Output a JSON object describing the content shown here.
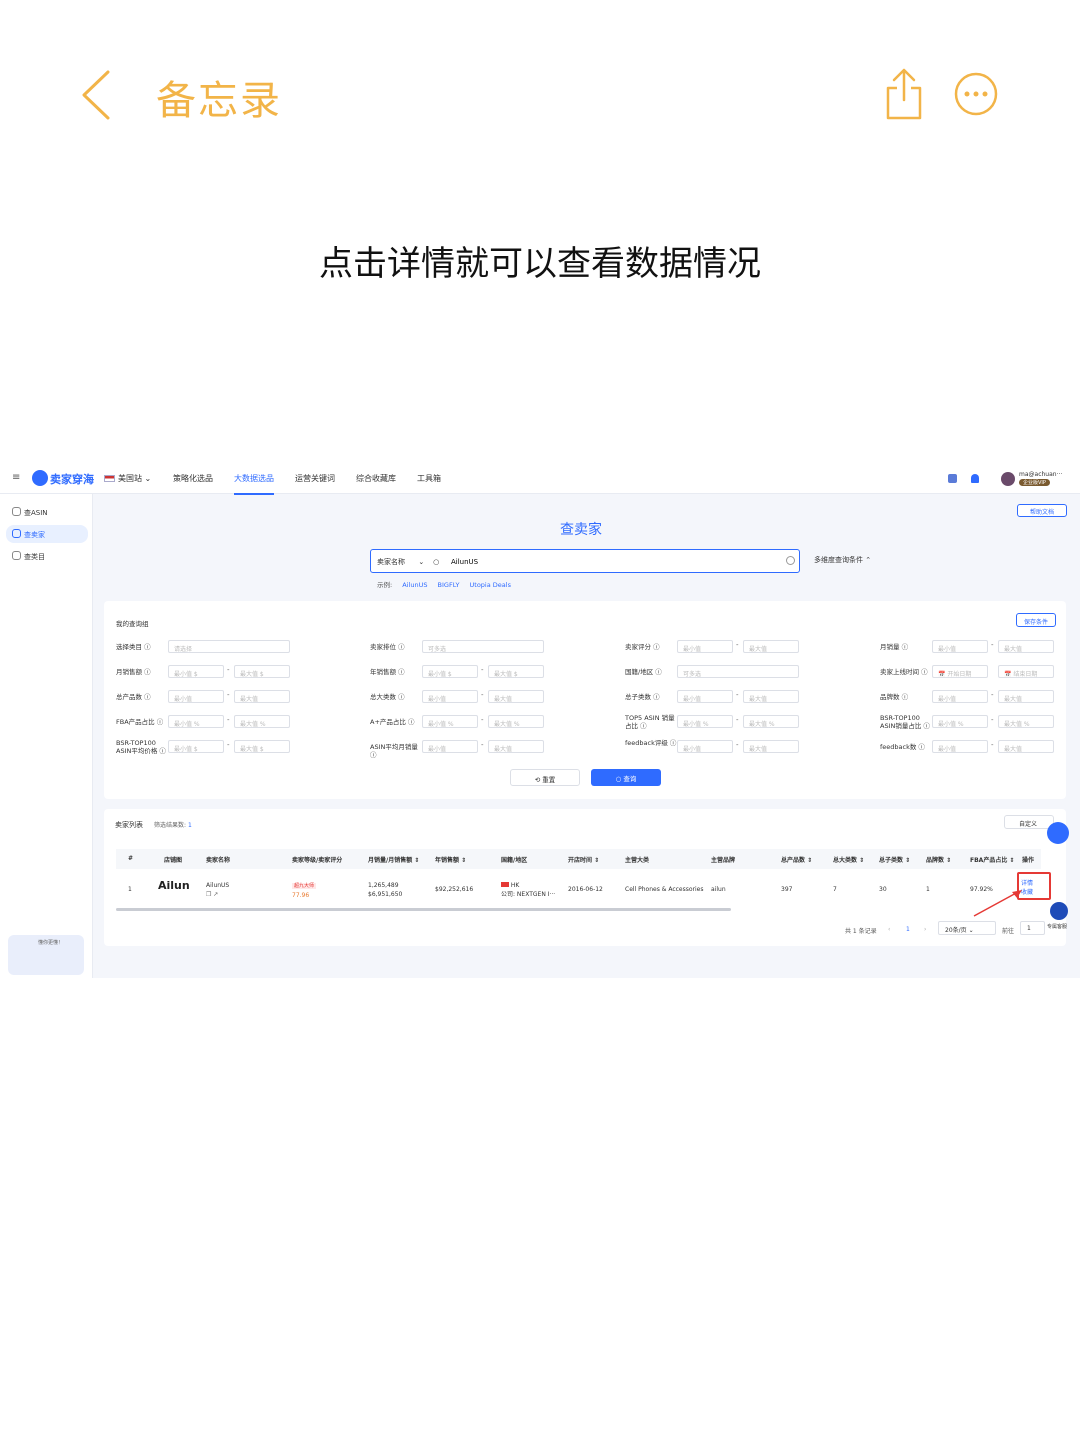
{
  "notes": {
    "title": "备忘录",
    "caption": "点击详情就可以查看数据情况"
  },
  "app": {
    "brand": "卖家穿海",
    "site": "美国站",
    "nav": [
      "策略化选品",
      "大数据选品",
      "运营关键词",
      "综合收藏库",
      "工具箱"
    ],
    "active_nav": "大数据选品",
    "user": "ma@achuan···",
    "vip": "企业版VIP",
    "help": "帮助文档"
  },
  "sidebar": {
    "items": [
      "查ASIN",
      "查卖家",
      "查类目"
    ],
    "promo": "懂你更懂！"
  },
  "search": {
    "page_title": "查卖家",
    "type": "卖家名称",
    "value": "AilunUS",
    "multi": "多维度查询条件 ⌃",
    "examples_label": "示例:",
    "examples": [
      "AilunUS",
      "BIGFLY",
      "Utopia Deals"
    ]
  },
  "filters": {
    "title": "我的查询组",
    "save": "保存条件",
    "min": "最小值",
    "max": "最大值",
    "select": "请选择",
    "multi": "可多选",
    "start_date": "开始日期",
    "end_date": "结束日期",
    "labels": {
      "c1": [
        "选择类目",
        "月销售额",
        "总产品数",
        "FBA产品占比",
        "BSR-TOP100 ASIN平均价格"
      ],
      "c2": [
        "卖家排位",
        "年销售额",
        "总大类数",
        "A+产品占比",
        "ASIN平均月销量"
      ],
      "c3": [
        "卖家评分",
        "国籍/地区",
        "总子类数",
        "TOP5 ASIN 销量占比",
        "feedback评级"
      ],
      "c4": [
        "月销量",
        "卖家上线时间",
        "品牌数",
        "BSR-TOP100 ASIN销量占比",
        "feedback数"
      ]
    },
    "reset": "重置",
    "query": "查询"
  },
  "list": {
    "title": "卖家列表",
    "count_label": "筛选结果数:",
    "count": "1",
    "custom": "自定义",
    "headers": [
      "#",
      "店铺图",
      "卖家名称",
      "卖家等级/卖家评分",
      "月销量/月销售额",
      "年销售额",
      "国籍/地区",
      "开店时间",
      "主营大类",
      "主营品牌",
      "总产品数",
      "总大类数",
      "总子类数",
      "品牌数",
      "FBA产品占比",
      "操作"
    ],
    "row": {
      "index": "1",
      "logo": "Ailun",
      "name": "AilunUS",
      "level": "超九大师",
      "rating": "77.96",
      "monthly_sales": "1,265,489",
      "monthly_revenue": "$6,951,650",
      "annual_revenue": "$92,252,616",
      "country": "HK",
      "company": "公司: NEXTGEN I···",
      "open_date": "2016-06-12",
      "main_category": "Cell Phones & Accessories",
      "main_brand": "ailun",
      "total_products": "397",
      "total_categories": "7",
      "total_subcategories": "30",
      "brands": "1",
      "fba_ratio": "97.92%",
      "action_detail": "详情",
      "action_collect": "收藏"
    },
    "pager": {
      "total": "共 1 条记录",
      "page": "1",
      "size": "20条/页",
      "goto": "前往",
      "goto_page": "1"
    },
    "service": "专属客服"
  },
  "colors": {
    "accent": "#2f6bff",
    "notes": "#f2b448",
    "highlight": "#e53935"
  }
}
